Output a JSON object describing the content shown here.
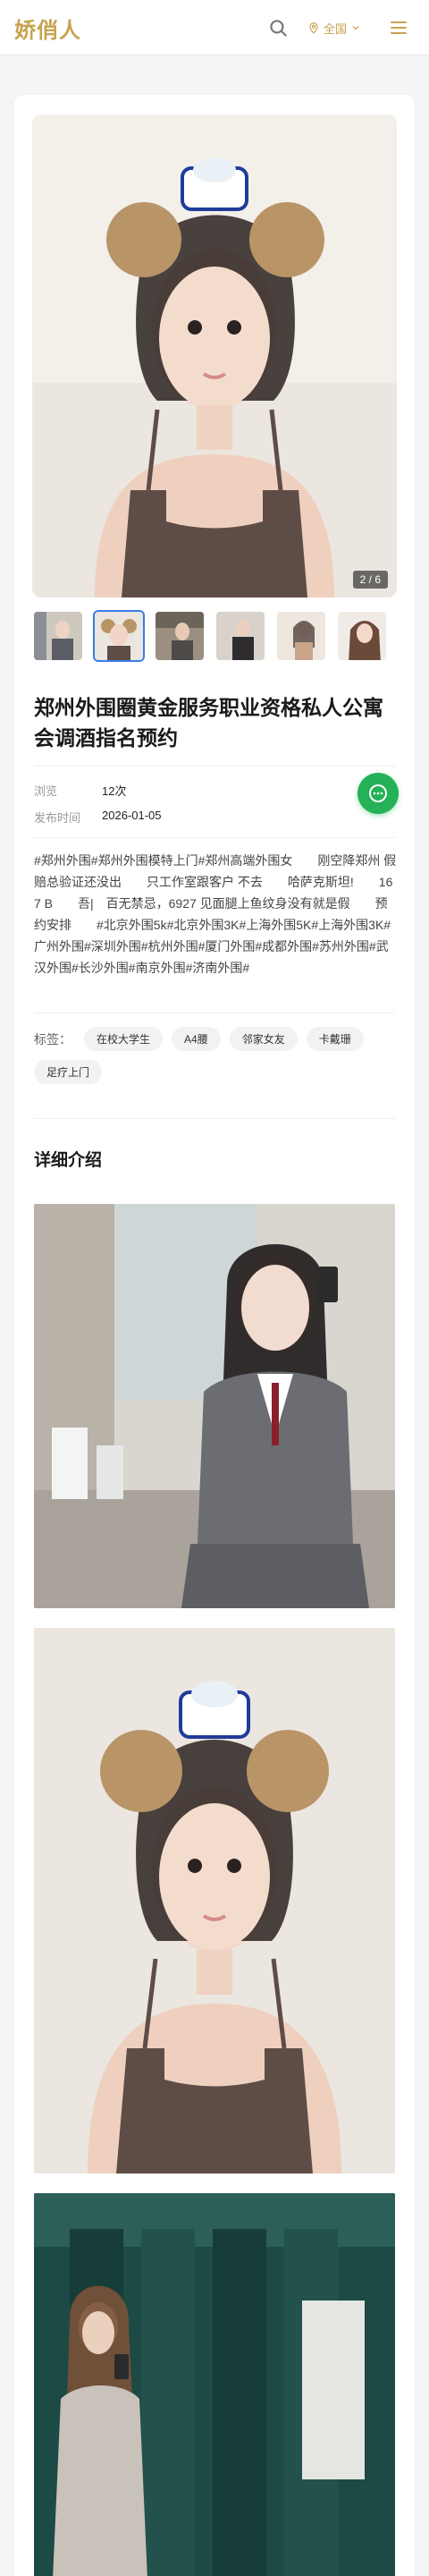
{
  "header": {
    "logo": "娇俏人",
    "region_label": "全国",
    "icons": {
      "search": "search-icon",
      "location": "location-pin-icon",
      "chevron": "chevron-down-icon",
      "menu": "menu-icon"
    }
  },
  "gallery": {
    "counter": "2 / 6",
    "thumb_count": 6,
    "active_index": 1
  },
  "post": {
    "title": "郑州外围圈黄金服务职业资格私人公寓会调酒指名预约",
    "views_label": "浏览",
    "views_value": "12次",
    "date_label": "发布时间",
    "date_value": "2026-01-05",
    "description": "#郑州外围#郑州外围模特上门#郑州高端外围女　　刚空降郑州 假赔总验证还没出　　只工作室跟客户 不去　　哈萨克斯坦!　　167 B　　吾|　百无禁忌，6927 见面腿上鱼纹身没有就是假　　预约安排　　#北京外围5k#北京外围3K#上海外围5K#上海外围3K#广州外围#深圳外围#杭州外围#厦门外围#成都外围#苏州外围#武汉外围#长沙外围#南京外围#济南外围#",
    "tags_label": "标签：",
    "tags": [
      "在校大学生",
      "A4腰",
      "邻家女友",
      "卡戴珊",
      "足疗上门"
    ]
  },
  "details": {
    "section_title": "详细介绍"
  },
  "colors": {
    "brand_gold": "#c9a24e",
    "accent_blue": "#3b7be8",
    "chat_green": "#24b157"
  }
}
